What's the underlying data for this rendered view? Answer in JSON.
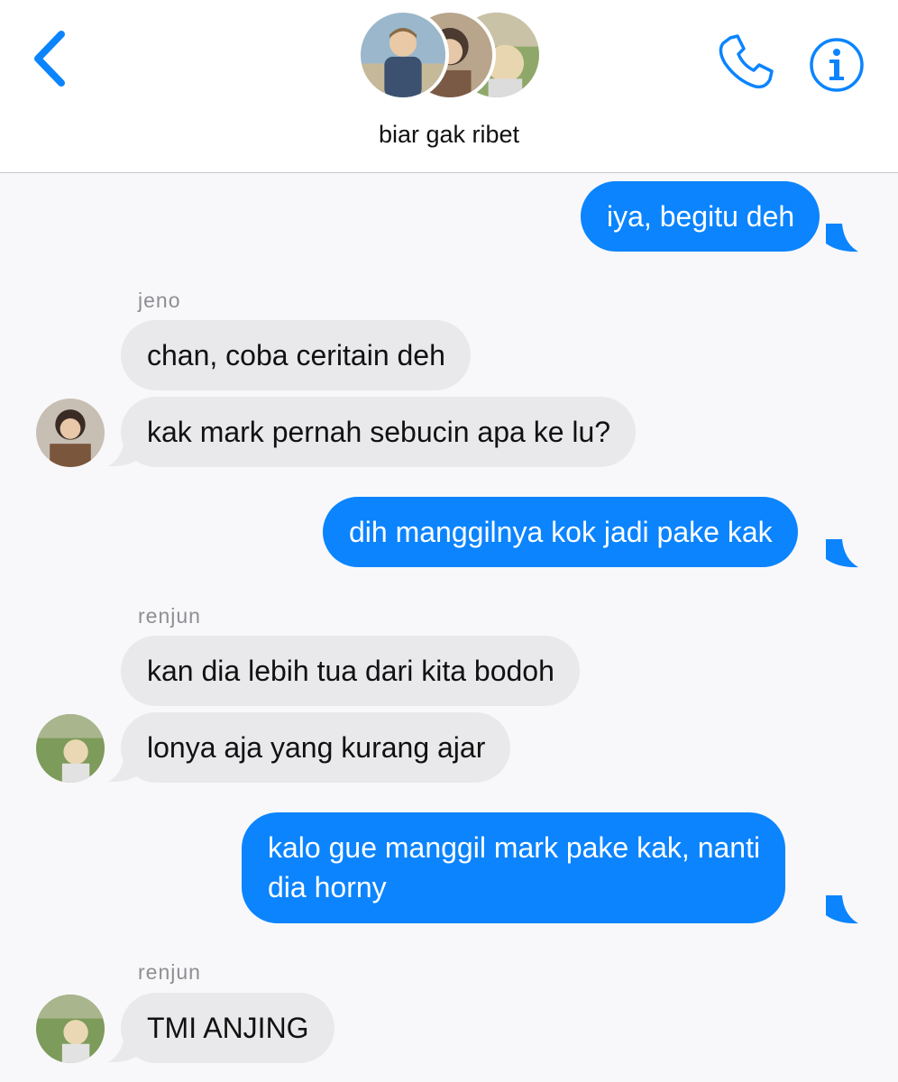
{
  "header": {
    "title": "biar gak ribet",
    "back_icon": "chevron-left-icon",
    "phone_icon": "phone-icon",
    "info_icon": "info-icon",
    "accent_color": "#0b84fe"
  },
  "messages": [
    {
      "side": "outgoing",
      "text": "iya, begitu deh"
    },
    {
      "side": "incoming",
      "sender": "jeno",
      "text": "chan, coba ceritain deh"
    },
    {
      "side": "incoming",
      "text": "kak mark pernah sebucin apa ke lu?"
    },
    {
      "side": "outgoing",
      "text": "dih manggilnya kok jadi pake kak"
    },
    {
      "side": "incoming",
      "sender": "renjun",
      "text": "kan dia lebih tua dari kita bodoh"
    },
    {
      "side": "incoming",
      "text": "lonya aja yang kurang ajar"
    },
    {
      "side": "outgoing",
      "text_line1": "kalo gue manggil mark pake kak, nanti",
      "text_line2": "dia horny"
    },
    {
      "side": "incoming",
      "sender": "renjun",
      "text": "TMI ANJING"
    }
  ],
  "colors": {
    "incoming_bubble": "#e9e9eb",
    "outgoing_bubble": "#0b84fe",
    "background": "#f8f8fa"
  }
}
